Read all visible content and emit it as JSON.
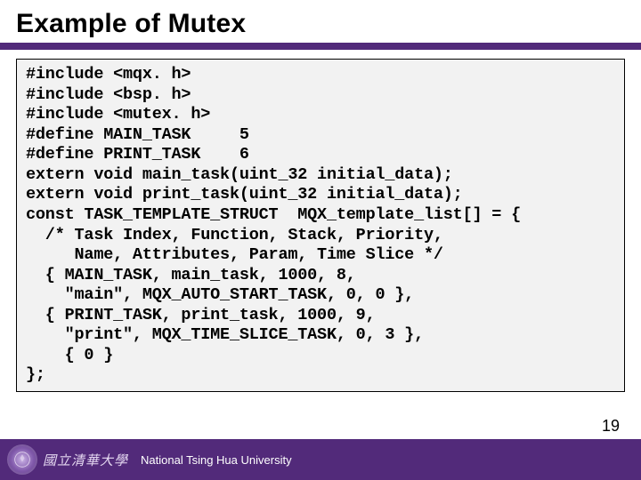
{
  "title": "Example of Mutex",
  "code": "#include <mqx. h>\n#include <bsp. h>\n#include <mutex. h>\n#define MAIN_TASK     5\n#define PRINT_TASK    6\nextern void main_task(uint_32 initial_data);\nextern void print_task(uint_32 initial_data);\nconst TASK_TEMPLATE_STRUCT  MQX_template_list[] = {\n  /* Task Index, Function, Stack, Priority,\n     Name, Attributes, Param, Time Slice */\n  { MAIN_TASK, main_task, 1000, 8,\n    \"main\", MQX_AUTO_START_TASK, 0, 0 },\n  { PRINT_TASK, print_task, 1000, 9,\n    \"print\", MQX_TIME_SLICE_TASK, 0, 3 },\n    { 0 }\n};",
  "footer": {
    "chinese": "國立清華大學",
    "english": "National Tsing Hua University"
  },
  "page_number": "19"
}
